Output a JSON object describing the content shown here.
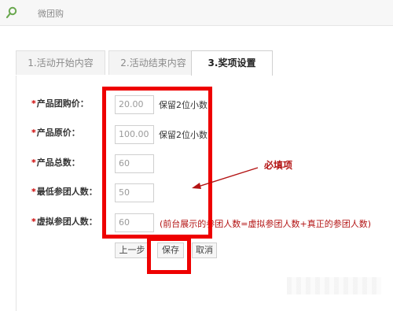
{
  "header": {
    "title": "微团购"
  },
  "tabs": [
    {
      "label": "1.活动开始内容"
    },
    {
      "label": "2.活动结束内容"
    },
    {
      "label": "3.奖项设置"
    }
  ],
  "form": {
    "fields": [
      {
        "label": "产品团购价：",
        "value": "20.00",
        "hint": "保留2位小数"
      },
      {
        "label": "产品原价：",
        "value": "100.00",
        "hint": "保留2位小数"
      },
      {
        "label": "产品总数：",
        "value": "60"
      },
      {
        "label": "最低参团人数：",
        "value": "50"
      },
      {
        "label": "虚拟参团人数：",
        "value": "60",
        "hint": "(前台展示的参团人数=虚拟参团人数+真正的参团人数)"
      }
    ],
    "required_mark": "*",
    "buttons": {
      "prev": "上一步",
      "save": "保存",
      "cancel": "取消"
    }
  },
  "annotation": {
    "text": "必填项"
  },
  "colors": {
    "accent_red": "#ee0000",
    "note_red": "#b31313",
    "logo_green": "#6aa84f"
  },
  "icons": {
    "logo": "magnifier-icon"
  }
}
